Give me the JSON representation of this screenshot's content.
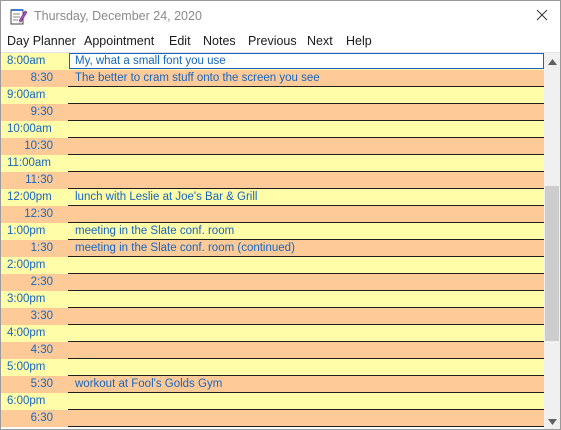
{
  "window": {
    "title": "Thursday, December 24, 2020",
    "icon": "notepad-pencil-icon",
    "close_icon": "close-icon"
  },
  "menu": {
    "items": [
      "Day Planner",
      "Appointment",
      "Edit",
      "Notes",
      "Previous",
      "Next",
      "Help"
    ]
  },
  "colors": {
    "hour_row": "#fffda8",
    "half_row": "#fecb98",
    "text": "#1565c0"
  },
  "schedule": [
    {
      "time": "8:00am",
      "entry": "My, what a small font you use"
    },
    {
      "time": "8:30",
      "entry": "The better to cram stuff onto the screen you see"
    },
    {
      "time": "9:00am",
      "entry": ""
    },
    {
      "time": "9:30",
      "entry": ""
    },
    {
      "time": "10:00am",
      "entry": ""
    },
    {
      "time": "10:30",
      "entry": ""
    },
    {
      "time": "11:00am",
      "entry": ""
    },
    {
      "time": "11:30",
      "entry": ""
    },
    {
      "time": "12:00pm",
      "entry": "lunch with Leslie at Joe's Bar & Grill"
    },
    {
      "time": "12:30",
      "entry": ""
    },
    {
      "time": "1:00pm",
      "entry": "meeting in the Slate conf. room"
    },
    {
      "time": "1:30",
      "entry": "meeting in the Slate conf. room (continued)"
    },
    {
      "time": "2:00pm",
      "entry": ""
    },
    {
      "time": "2:30",
      "entry": ""
    },
    {
      "time": "3:00pm",
      "entry": ""
    },
    {
      "time": "3:30",
      "entry": ""
    },
    {
      "time": "4:00pm",
      "entry": ""
    },
    {
      "time": "4:30",
      "entry": ""
    },
    {
      "time": "5:00pm",
      "entry": ""
    },
    {
      "time": "5:30",
      "entry": "workout at Fool's Golds Gym"
    },
    {
      "time": "6:00pm",
      "entry": ""
    },
    {
      "time": "6:30",
      "entry": ""
    }
  ]
}
